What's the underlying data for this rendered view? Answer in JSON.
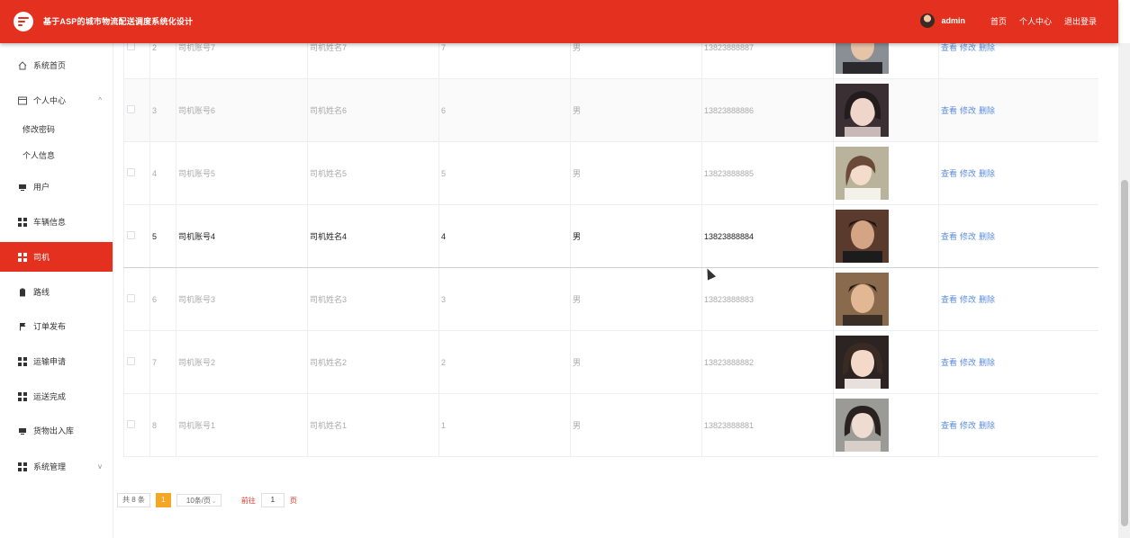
{
  "header": {
    "title": "基于ASP的城市物流配送调度系统化设计",
    "username": "admin",
    "links": [
      "首页",
      "个人中心",
      "退出登录"
    ],
    "bg_color": "#e4301f"
  },
  "sidebar": {
    "items": [
      {
        "label": "系统首页",
        "icon": "home-icon"
      },
      {
        "label": "个人中心",
        "icon": "window-icon",
        "expanded": true
      },
      {
        "label": "用户",
        "icon": "monitor-icon"
      },
      {
        "label": "车辆信息",
        "icon": "grid-icon"
      },
      {
        "label": "司机",
        "icon": "grid-icon",
        "active": true
      },
      {
        "label": "路线",
        "icon": "clipboard-icon"
      },
      {
        "label": "订单发布",
        "icon": "flag-icon"
      },
      {
        "label": "运输申请",
        "icon": "grid-icon"
      },
      {
        "label": "运送完成",
        "icon": "grid-icon"
      },
      {
        "label": "货物出入库",
        "icon": "monitor-icon"
      },
      {
        "label": "系统管理",
        "icon": "grid-icon"
      }
    ],
    "subitems": [
      "修改密码",
      "个人信息"
    ],
    "active_color": "#e4301f"
  },
  "table": {
    "rows": [
      {
        "index": "2",
        "account": "司机账号7",
        "name": "司机姓名7",
        "no": "7",
        "gender": "男",
        "phone": "13823888887"
      },
      {
        "index": "3",
        "account": "司机账号6",
        "name": "司机姓名6",
        "no": "6",
        "gender": "男",
        "phone": "13823888886"
      },
      {
        "index": "4",
        "account": "司机账号5",
        "name": "司机姓名5",
        "no": "5",
        "gender": "男",
        "phone": "13823888885"
      },
      {
        "index": "5",
        "account": "司机账号4",
        "name": "司机姓名4",
        "no": "4",
        "gender": "男",
        "phone": "13823888884"
      },
      {
        "index": "6",
        "account": "司机账号3",
        "name": "司机姓名3",
        "no": "3",
        "gender": "男",
        "phone": "13823888883"
      },
      {
        "index": "7",
        "account": "司机账号2",
        "name": "司机姓名2",
        "no": "2",
        "gender": "男",
        "phone": "13823888882"
      },
      {
        "index": "8",
        "account": "司机账号1",
        "name": "司机姓名1",
        "no": "1",
        "gender": "男",
        "phone": "13823888881"
      }
    ],
    "actions": [
      "查看",
      "修改",
      "删除"
    ]
  },
  "pagination": {
    "total": "共 8 条",
    "current": "1",
    "page_size": "10条/页",
    "goto": "前往",
    "page_input": "1",
    "page_unit": "页"
  }
}
